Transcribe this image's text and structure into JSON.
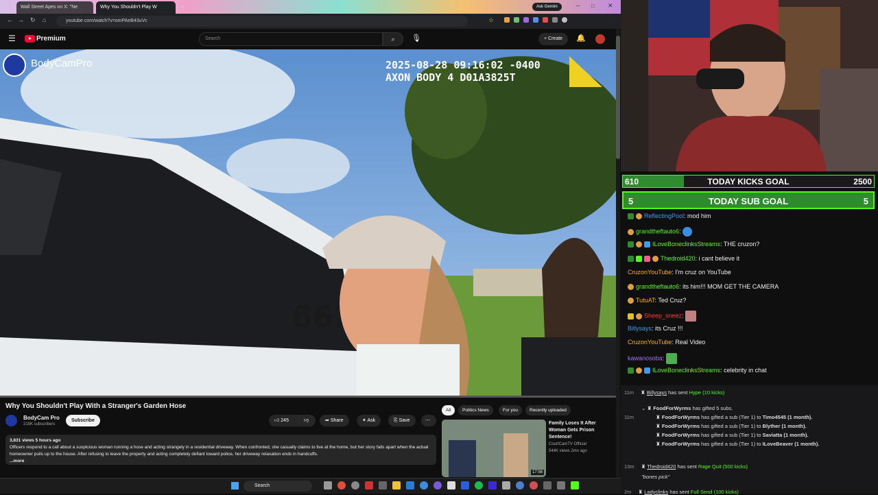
{
  "browser": {
    "tabs": [
      {
        "label": "Wall Street Apes on X: \"Ne"
      },
      {
        "label": "Why You Shouldn't Play W"
      }
    ],
    "gemini_label": "Ask Gemini",
    "url": "youtube.com/watch?v=omPAeB43uVc"
  },
  "youtube": {
    "brand": "Premium",
    "search_placeholder": "Search",
    "create_label": "Create",
    "video_overlay": {
      "channel_logo_text": "BodyCamPro",
      "timestamp": "2025-08-28 09:16:02 -0400",
      "device": "AXON BODY 4 D01A3825T",
      "car_number": "662"
    },
    "video_title": "Why You Shouldn't Play With a Stranger's Garden Hose",
    "channel_name": "BodyCam Pro",
    "subscribers": "215K subscribers",
    "subscribe_label": "Subscribe",
    "likes": "245",
    "share_label": "Share",
    "ask_label": "Ask",
    "save_label": "Save",
    "desc_meta": "3,831 views  5 hours ago",
    "desc_text": "Officers respond to a call about a suspicious woman running a hose and acting strangely in a residential driveway. When confronted, she casually claims to live at the home, but her story falls apart when the actual homeowner pulls up to the house. After refusing to leave the property and acting completely defiant toward police, her driveway relaxation ends in handcuffs.",
    "more_label": "...more",
    "chips": [
      "All",
      "Politics News",
      "For you",
      "Recently uploaded"
    ],
    "rec": {
      "title": "Family Loses It After Woman Gets Prison Sentence!",
      "channel": "CourtCamTV Official",
      "meta": "544K views  2mo ago",
      "duration": "17:58"
    }
  },
  "taskbar": {
    "search_label": "Search"
  },
  "stream": {
    "kicks_goal": {
      "current": "610",
      "label": "TODAY KICKS GOAL",
      "target": "2500",
      "progress": 0.244
    },
    "sub_goal": {
      "current": "5",
      "label": "TODAY SUB GOAL",
      "target": "5",
      "progress": 1.0
    },
    "chat": [
      {
        "user": "ReflectingPool",
        "color": "#3d9be9",
        "text": ": mod him"
      },
      {
        "user": "grandtheftauto6",
        "color": "#53fc18",
        "text": ":"
      },
      {
        "user": "ILoveBoneclinksStreams",
        "color": "#53fc18",
        "text": ": THE cruzon?"
      },
      {
        "user": "Thedroid420",
        "color": "#53fc18",
        "text": ": i cant believe it"
      },
      {
        "user": "CruzonYouTube",
        "color": "#ffb000",
        "text": ": I'm cruz on YouTube"
      },
      {
        "user": "grandtheftauto6",
        "color": "#53fc18",
        "text": ": its him!!! MOM GET THE CAMERA"
      },
      {
        "user": "TutuAT",
        "color": "#ffb000",
        "text": ": Ted Cruz?"
      },
      {
        "user": "Sheep_sneez",
        "color": "#ff3b3b",
        "text": ":"
      },
      {
        "user": "Billysays",
        "color": "#3d9be9",
        "text": ": its Cruz !!!"
      },
      {
        "user": "CruzonYouTube",
        "color": "#ffb000",
        "text": ": Real Video"
      },
      {
        "user": "kawanosoba",
        "color": "#a970ff",
        "text": ":"
      },
      {
        "user": "ILoveBoneclinksStreams",
        "color": "#53fc18",
        "text": ": celebrity in chat"
      }
    ],
    "events": [
      {
        "time": "11m",
        "user": "Billysays",
        "text": " has sent ",
        "item": "Hype (10 kicks)"
      },
      {
        "time": "",
        "user": "FoodForWyrms",
        "text": " has gifted 5 subs.",
        "item": ""
      },
      {
        "time": "11m",
        "user": "FoodForWyrms",
        "text": " has gifted a sub (Tier 1) to ",
        "item": "Timo4545 (1 month)."
      },
      {
        "time": "",
        "user": "FoodForWyrms",
        "text": " has gifted a sub (Tier 1) to ",
        "item": "Blyther (1 month)."
      },
      {
        "time": "",
        "user": "FoodForWyrms",
        "text": " has gifted a sub (Tier 1) to ",
        "item": "Saviatta (1 month)."
      },
      {
        "time": "",
        "user": "FoodForWyrms",
        "text": " has gifted a sub (Tier 1) to ",
        "item": "ILoveBeaver (1 month)."
      },
      {
        "time": "13m",
        "user": "Thedroid420",
        "text": " has sent ",
        "item": "Rage Quit (500 kicks)"
      },
      {
        "time": "",
        "user": "",
        "text": "\"bones pick\"",
        "item": ""
      },
      {
        "time": "2m",
        "user": "Ladyclinks",
        "text": " has sent ",
        "item": "Full Send (100 kicks)"
      }
    ]
  }
}
